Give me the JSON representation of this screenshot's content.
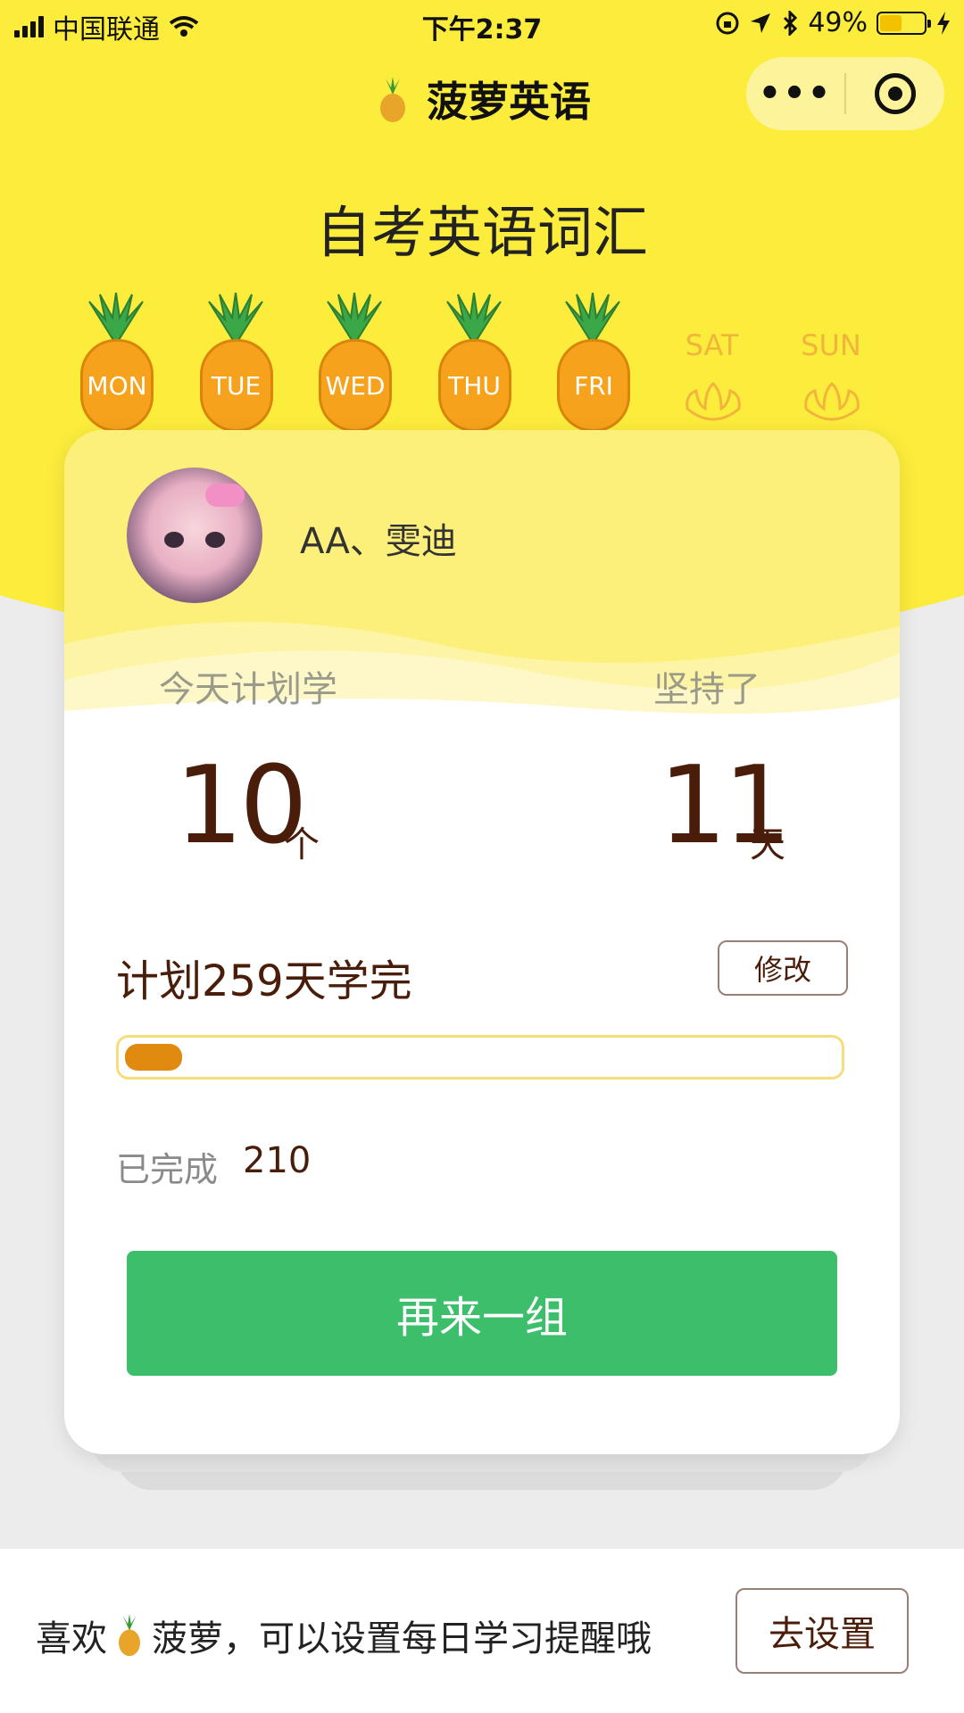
{
  "status_bar": {
    "carrier": "中国联通",
    "time": "下午2:37",
    "battery": "49%",
    "battery_level": 0.49
  },
  "nav": {
    "title": "菠萝英语",
    "more_icon": "more-dots-icon",
    "close_icon": "target-icon"
  },
  "page_title": "自考英语词汇",
  "week": {
    "days": [
      {
        "label": "MON",
        "done": true
      },
      {
        "label": "TUE",
        "done": true
      },
      {
        "label": "WED",
        "done": true
      },
      {
        "label": "THU",
        "done": true
      },
      {
        "label": "FRI",
        "done": true
      },
      {
        "label": "SAT",
        "done": false
      },
      {
        "label": "SUN",
        "done": false
      }
    ]
  },
  "card": {
    "username": "AA、雯迪",
    "today_label": "今天计划学",
    "streak_label": "坚持了",
    "today_value": "10",
    "today_unit": "个",
    "streak_value": "11",
    "streak_unit": "天",
    "plan_text": "计划259天学完",
    "edit_label": "修改",
    "progress_fraction": 0.08,
    "done_label": "已完成",
    "done_value": "210",
    "again_label": "再来一组"
  },
  "bottom": {
    "tip_prefix": "喜欢",
    "tip_suffix": "菠萝，可以设置每日学习提醒哦",
    "goto_label": "去设置"
  },
  "colors": {
    "header_yellow": "#fcec3c",
    "card_yellow": "#fcf07a",
    "pineapple_orange": "#f6a21c",
    "brown_text": "#4a1d0a",
    "green_button": "#3dbe6a",
    "progress_fill": "#e08a10"
  }
}
